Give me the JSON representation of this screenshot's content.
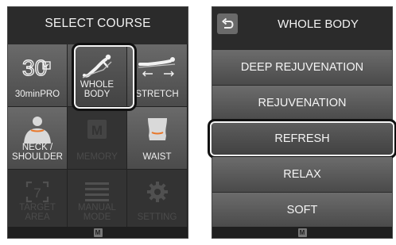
{
  "left": {
    "title": "SELECT COURSE",
    "tiles": [
      {
        "label": "30minPRO",
        "icon": "timer-30-icon",
        "enabled": true
      },
      {
        "label": "WHOLE\nBODY",
        "icon": "reclining-body-icon",
        "enabled": true,
        "selected": true
      },
      {
        "label": "STRETCH",
        "icon": "stretch-body-icon",
        "enabled": true
      },
      {
        "label": "NECK /\nSHOULDER",
        "icon": "neck-shoulder-icon",
        "enabled": true
      },
      {
        "label": "MEMORY",
        "icon": "memory-m-icon",
        "enabled": false
      },
      {
        "label": "WAIST",
        "icon": "waist-icon",
        "enabled": true
      },
      {
        "label": "TARGET\nAREA",
        "icon": "target-area-icon",
        "enabled": false
      },
      {
        "label": "MANUAL\nMODE",
        "icon": "manual-lines-icon",
        "enabled": false
      },
      {
        "label": "SETTING",
        "icon": "gear-icon",
        "enabled": false
      }
    ],
    "footer_icon": "M"
  },
  "right": {
    "title": "WHOLE BODY",
    "back_icon": "back-arrow-icon",
    "courses": [
      {
        "label": "DEEP REJUVENATION",
        "selected": false
      },
      {
        "label": "REJUVENATION",
        "selected": false
      },
      {
        "label": "REFRESH",
        "selected": true
      },
      {
        "label": "RELAX",
        "selected": false
      },
      {
        "label": "SOFT",
        "selected": false
      }
    ],
    "footer_icon": "M"
  }
}
